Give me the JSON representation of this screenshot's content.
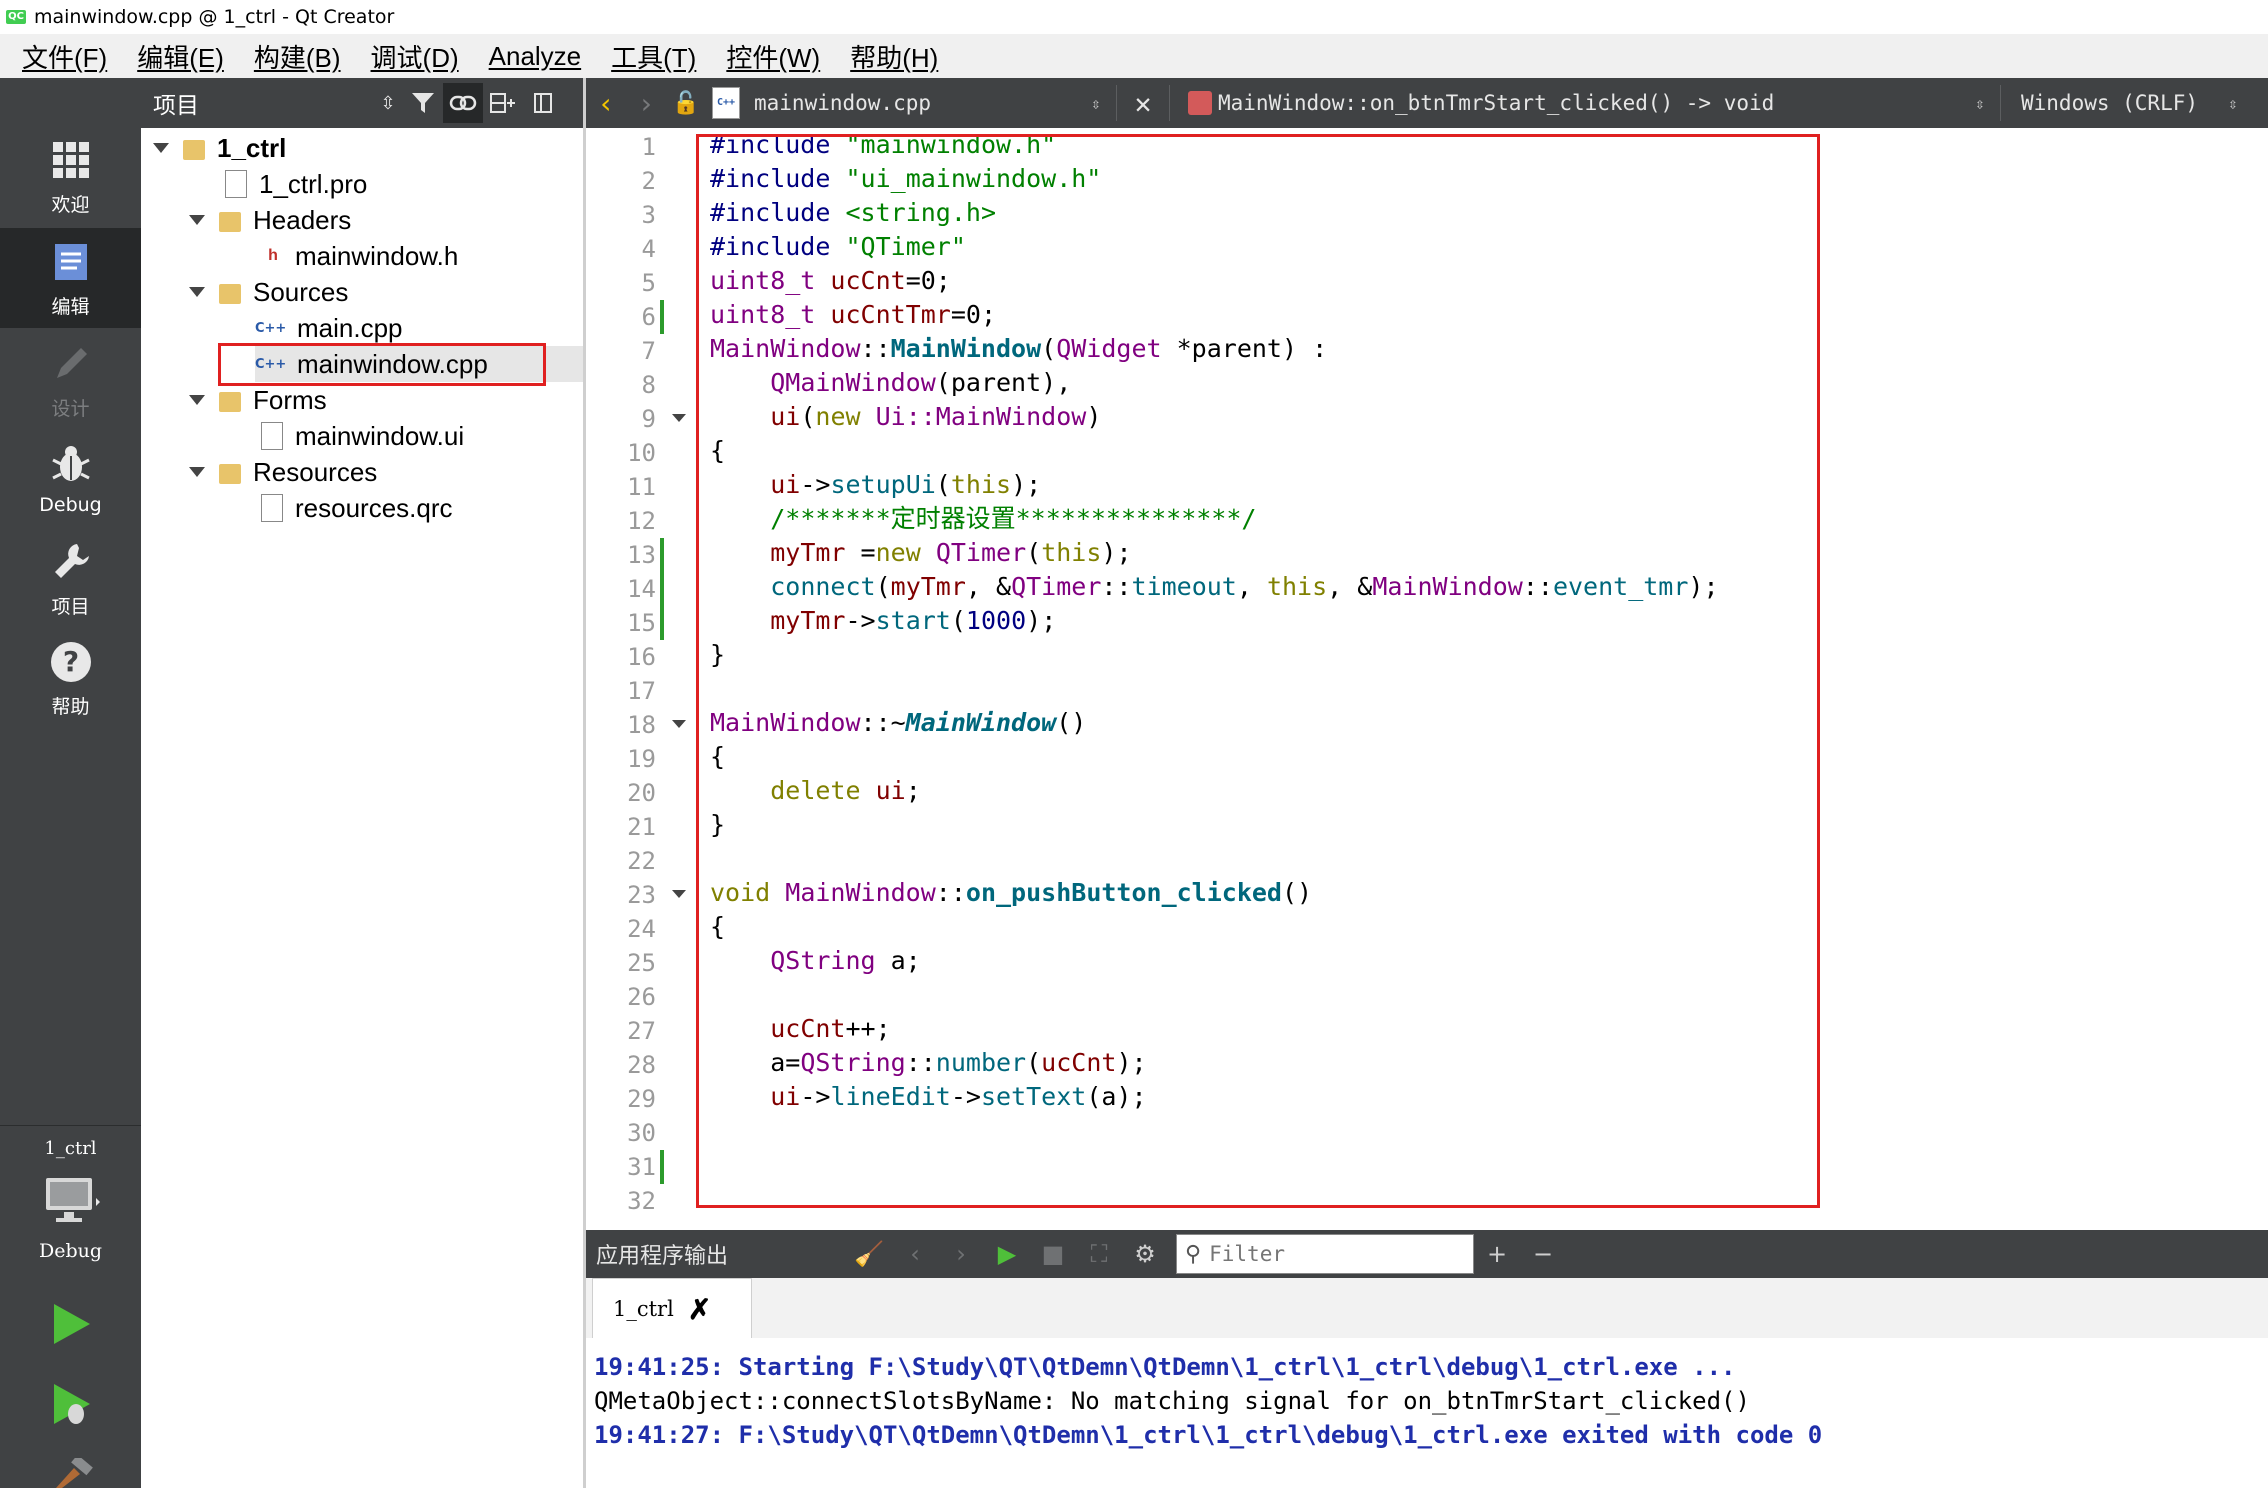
{
  "window": {
    "title": "mainwindow.cpp @ 1_ctrl - Qt Creator",
    "logo": "QC"
  },
  "menu": [
    "文件(F)",
    "编辑(E)",
    "构建(B)",
    "调试(D)",
    "Analyze",
    "工具(T)",
    "控件(W)",
    "帮助(H)"
  ],
  "modes": [
    {
      "label": "欢迎",
      "icon": "welcome-grid-icon"
    },
    {
      "label": "编辑",
      "icon": "edit-document-icon"
    },
    {
      "label": "设计",
      "icon": "design-pencil-icon"
    },
    {
      "label": "Debug",
      "icon": "debug-bug-icon"
    },
    {
      "label": "项目",
      "icon": "project-wrench-icon"
    },
    {
      "label": "帮助",
      "icon": "help-question-icon"
    }
  ],
  "kit": {
    "project": "1_ctrl",
    "build_mode": "Debug"
  },
  "project_pane": {
    "title": "项目"
  },
  "tree": {
    "root": "1_ctrl",
    "pro": "1_ctrl.pro",
    "headers": "Headers",
    "header_file": "mainwindow.h",
    "sources": "Sources",
    "source_main": "main.cpp",
    "source_mainwindow": "mainwindow.cpp",
    "forms": "Forms",
    "form_file": "mainwindow.ui",
    "resources": "Resources",
    "resource_file": "resources.qrc"
  },
  "editor_bar": {
    "file": "mainwindow.cpp",
    "function": "MainWindow::on_btnTmrStart_clicked() -> void",
    "encoding": "Windows (CRLF)"
  },
  "code": {
    "line_numbers": [
      "1",
      "2",
      "3",
      "4",
      "5",
      "6",
      "7",
      "8",
      "9",
      "10",
      "11",
      "12",
      "13",
      "14",
      "15",
      "16",
      "17",
      "18",
      "19",
      "20",
      "21",
      "22",
      "23",
      "24",
      "25",
      "26",
      "27",
      "28",
      "29",
      "30",
      "31",
      "32"
    ],
    "inc1_kw": "#include",
    "inc1_str": "\"mainwindow.h\"",
    "inc2_kw": "#include",
    "inc2_str": "\"ui_mainwindow.h\"",
    "inc3_kw": "#include",
    "inc3_str": "<string.h>",
    "inc4_kw": "#include",
    "inc4_str": "\"QTimer\"",
    "l5_type": "uint8_t",
    "l5_var": "ucCnt",
    "l5_rest": "=0;",
    "l6_type": "uint8_t",
    "l6_var": "ucCntTmr",
    "l6_rest": "=0;",
    "l7_cls": "MainWindow",
    "l7_sep": "::",
    "l7_fn": "MainWindow",
    "l7_p1": "(",
    "l7_type": "QWidget",
    "l7_rest": " *parent) :",
    "l8_fn": "QMainWindow",
    "l8_rest": "(parent),",
    "l9_fn": "ui",
    "l9_p": "(",
    "l9_kw": "new",
    "l9_cls": " Ui::MainWindow",
    "l9_rest": ")",
    "l10": "{",
    "l11_var": "ui",
    "l11_arrow": "->",
    "l11_fn": "setupUi",
    "l11_p": "(",
    "l11_kw": "this",
    "l11_rest": ");",
    "l12_cm": "/*******定时器设置***************/",
    "l13_var": "myTmr",
    "l13_eq": " =",
    "l13_kw": "new",
    "l13_sp": " ",
    "l13_typ": "QTimer",
    "l13_p": "(",
    "l13_this": "this",
    "l13_rest": ");",
    "l14_fn": "connect",
    "l14_a": "(",
    "l14_var": "myTmr",
    "l14_b": ", &",
    "l14_typ": "QTimer",
    "l14_c": "::",
    "l14_fn2": "timeout",
    "l14_d": ", ",
    "l14_this": "this",
    "l14_e": ", &",
    "l14_cls": "MainWindow",
    "l14_f": "::",
    "l14_fn3": "event_tmr",
    "l14_g": ");",
    "l15_var": "myTmr",
    "l15_arrow": "->",
    "l15_fn": "start",
    "l15_p": "(",
    "l15_num": "1000",
    "l15_rest": ");",
    "l16": "}",
    "l18_cls": "MainWindow",
    "l18_sep": "::~",
    "l18_fn": "MainWindow",
    "l18_rest": "()",
    "l19": "{",
    "l20_kw": "delete",
    "l20_var": " ui",
    "l20_rest": ";",
    "l21": "}",
    "l23_kw": "void",
    "l23_cls": " MainWindow",
    "l23_sep": "::",
    "l23_fn": "on_pushButton_clicked",
    "l23_rest": "()",
    "l24": "{",
    "l25_typ": "QString",
    "l25_rest": " a;",
    "l27_var": "ucCnt",
    "l27_rest": "++;",
    "l28_a": "a=",
    "l28_typ": "QString",
    "l28_sep": "::",
    "l28_fn": "number",
    "l28_p": "(",
    "l28_var": "ucCnt",
    "l28_rest": ");",
    "l29_var": "ui",
    "l29_arrow": "->",
    "l29_fn": "lineEdit",
    "l29_arrow2": "->",
    "l29_fn2": "setText",
    "l29_rest": "(a);"
  },
  "output": {
    "title": "应用程序输出",
    "filter_placeholder": "Filter",
    "tab": "1_ctrl",
    "lines": [
      "19:41:25: Starting F:\\Study\\QT\\QtDemn\\QtDemn\\1_ctrl\\1_ctrl\\debug\\1_ctrl.exe ...",
      "QMetaObject::connectSlotsByName: No matching signal for on_btnTmrStart_clicked()",
      "19:41:27: F:\\Study\\QT\\QtDemn\\QtDemn\\1_ctrl\\1_ctrl\\debug\\1_ctrl.exe exited with code 0"
    ]
  },
  "colors": {
    "sidebar": "#404244",
    "sidebar_active": "#262829",
    "highlight_box": "#e02020",
    "run_green": "#4fbf3a"
  }
}
